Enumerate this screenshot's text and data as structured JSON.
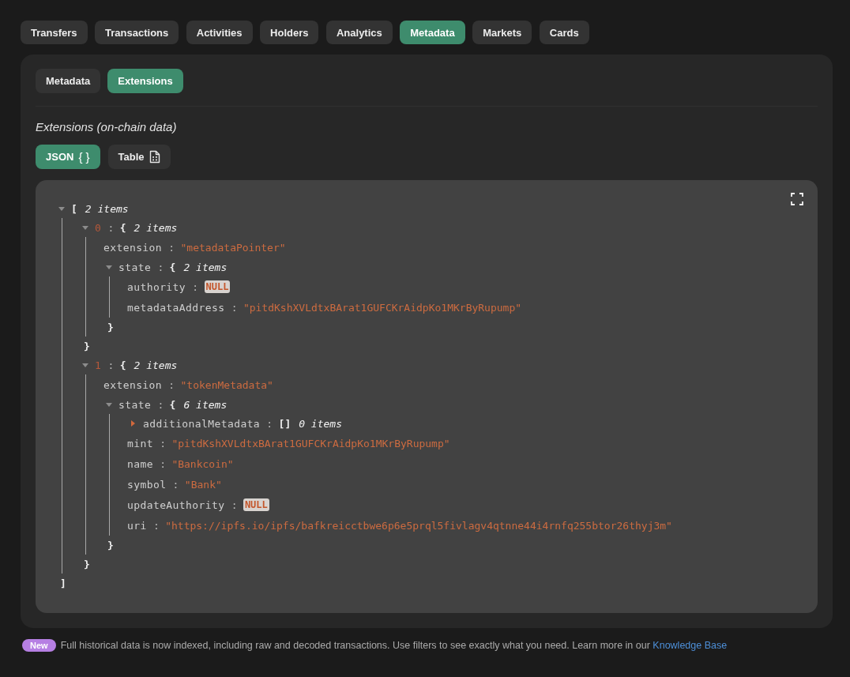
{
  "tabs": [
    {
      "label": "Transfers",
      "selected": false
    },
    {
      "label": "Transactions",
      "selected": false
    },
    {
      "label": "Activities",
      "selected": false
    },
    {
      "label": "Holders",
      "selected": false
    },
    {
      "label": "Analytics",
      "selected": false
    },
    {
      "label": "Metadata",
      "selected": true
    },
    {
      "label": "Markets",
      "selected": false
    },
    {
      "label": "Cards",
      "selected": false
    }
  ],
  "subtabs": [
    {
      "label": "Metadata",
      "selected": false
    },
    {
      "label": "Extensions",
      "selected": true
    }
  ],
  "section_title": "Extensions (on-chain data)",
  "view_toggle": [
    {
      "kind": "json",
      "label": "JSON",
      "symbol": "{ }",
      "selected": true
    },
    {
      "kind": "table",
      "label": "Table",
      "selected": false
    }
  ],
  "json_viewer": {
    "tree": {
      "kind": "array",
      "expanded": true,
      "open": "[",
      "count": "2 items",
      "close": "]",
      "children": [
        {
          "kind": "object",
          "key": "0",
          "sep": ":",
          "expanded": true,
          "open": "{",
          "count": "2 items",
          "close": "}",
          "children": [
            {
              "kind": "string",
              "key": "extension",
              "sep": ":",
              "value": "\"metadataPointer\""
            },
            {
              "kind": "object",
              "key": "state",
              "sep": ":",
              "expanded": true,
              "open": "{",
              "count": "2 items",
              "close": "}",
              "children": [
                {
                  "kind": "null",
                  "key": "authority",
                  "sep": ":",
                  "value": "NULL"
                },
                {
                  "kind": "string",
                  "key": "metadataAddress",
                  "sep": ":",
                  "value": "\"pitdKshXVLdtxBArat1GUFCKrAidpKo1MKrByRupump\""
                }
              ]
            }
          ]
        },
        {
          "kind": "object",
          "key": "1",
          "sep": ":",
          "expanded": true,
          "open": "{",
          "count": "2 items",
          "close": "}",
          "children": [
            {
              "kind": "string",
              "key": "extension",
              "sep": ":",
              "value": "\"tokenMetadata\""
            },
            {
              "kind": "object",
              "key": "state",
              "sep": ":",
              "expanded": true,
              "open": "{",
              "count": "6 items",
              "close": "}",
              "children": [
                {
                  "kind": "array",
                  "key": "additionalMetadata",
                  "sep": ":",
                  "expanded": false,
                  "open": "[]",
                  "count": "0 items"
                },
                {
                  "kind": "string",
                  "key": "mint",
                  "sep": ":",
                  "value": "\"pitdKshXVLdtxBArat1GUFCKrAidpKo1MKrByRupump\""
                },
                {
                  "kind": "string",
                  "key": "name",
                  "sep": ":",
                  "value": "\"Bankcoin\""
                },
                {
                  "kind": "string",
                  "key": "symbol",
                  "sep": ":",
                  "value": "\"Bank\""
                },
                {
                  "kind": "null",
                  "key": "updateAuthority",
                  "sep": ":",
                  "value": "NULL"
                },
                {
                  "kind": "string",
                  "key": "uri",
                  "sep": ":",
                  "value": "\"https://ipfs.io/ipfs/bafkreicctbwe6p6e5prql5fivlagv4qtnne44i4rnfq255btor26thyj3m\""
                }
              ]
            }
          ]
        }
      ]
    }
  },
  "notice": {
    "badge": "New",
    "text": "Full historical data is now indexed, including raw and decoded transactions. Use filters to see exactly what you need. Learn more in our",
    "link": "Knowledge Base"
  }
}
